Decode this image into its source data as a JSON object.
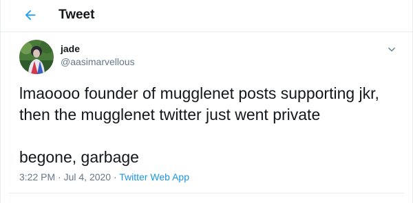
{
  "header": {
    "title": "Tweet",
    "back_icon": "arrow-left-icon"
  },
  "tweet": {
    "author": {
      "name": "jade",
      "handle": "@aasimarvellous"
    },
    "text_lines": [
      "lmaoooo founder of mugglenet posts supporting jkr,",
      "then the mugglenet twitter just went private",
      "begone, garbage"
    ],
    "time": "3:22 PM",
    "separator_1": " · ",
    "date": "Jul 4, 2020",
    "separator_2": " · ",
    "source": "Twitter Web App"
  },
  "colors": {
    "accent": "#1da1f2",
    "link": "#1b95e0",
    "text_primary": "#14171a",
    "text_secondary": "#657786",
    "border": "#e6ecf0"
  },
  "icons": [
    "arrow-left-icon",
    "chevron-down-icon"
  ]
}
